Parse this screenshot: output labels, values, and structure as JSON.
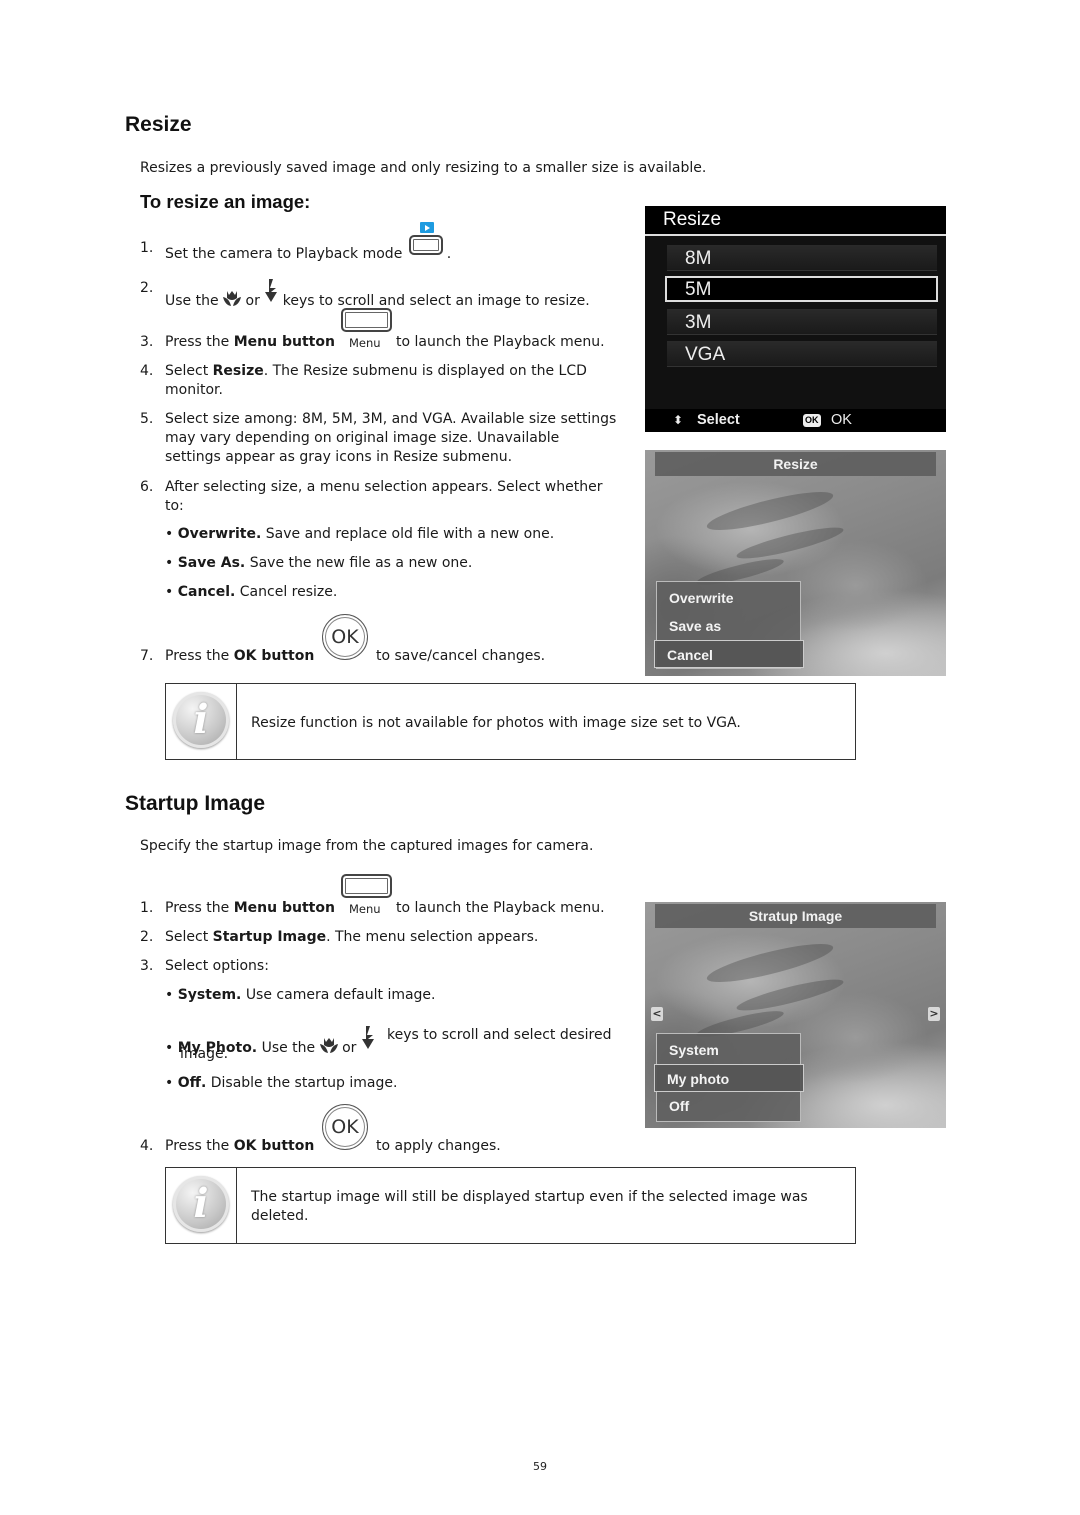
{
  "resize": {
    "title": "Resize",
    "intro": "Resizes a previously saved image and only resizing to a smaller size is available.",
    "subtitle": "To resize an image:",
    "steps": [
      {
        "n": "1.",
        "text_a": "Set the camera to Playback mode",
        "text_b": "."
      },
      {
        "n": "2.",
        "text_a": "Use the",
        "text_or": "or",
        "text_b": "keys to scroll and select an image to resize."
      },
      {
        "n": "3.",
        "text_a": "Press the",
        "bold": "Menu button",
        "key_label": "Menu",
        "text_b": "to launch the Playback menu."
      },
      {
        "n": "4.",
        "text_a": "Select",
        "bold": "Resize",
        "text_b": ". The Resize submenu is displayed on the LCD monitor."
      },
      {
        "n": "5.",
        "text": "Select size among: 8M, 5M, 3M, and VGA. Available size settings may vary depending on original image size. Unavailable settings appear as gray icons in Resize submenu."
      },
      {
        "n": "6.",
        "text": "After selecting size, a menu selection appears. Select whether to:"
      },
      {
        "n": "7.",
        "text_a": "Press the",
        "bold": "OK button",
        "key_label": "OK",
        "text_b": "to save/cancel changes."
      }
    ],
    "bullets": [
      {
        "bold": "Overwrite.",
        "text": "Save and replace old file with a new one."
      },
      {
        "bold": "Save As.",
        "text": "Save the new file as a new one."
      },
      {
        "bold": "Cancel.",
        "text": "Cancel resize."
      }
    ],
    "lcd_menu": {
      "title": "Resize",
      "items": [
        "8M",
        "5M",
        "3M",
        "VGA"
      ],
      "selected": "5M",
      "footer_select": "Select",
      "footer_ok_chip": "OK",
      "footer_ok": "OK"
    },
    "lcd_confirm": {
      "title": "Resize",
      "options": [
        "Overwrite",
        "Save as",
        "Cancel"
      ],
      "selected": "Cancel"
    },
    "note": "Resize function is not available for photos with image size set to VGA."
  },
  "startup": {
    "title": "Startup Image",
    "intro": "Specify the startup image from the captured images for camera.",
    "steps": [
      {
        "n": "1.",
        "text_a": "Press the",
        "bold": "Menu button",
        "key_label": "Menu",
        "text_b": "to launch the Playback menu."
      },
      {
        "n": "2.",
        "text_a": "Select",
        "bold": "Startup Image",
        "text_b": ". The menu selection appears."
      },
      {
        "n": "3.",
        "text": "Select options:"
      },
      {
        "n": "4.",
        "text_a": "Press the",
        "bold": "OK button",
        "key_label": "OK",
        "text_b": "to apply changes."
      }
    ],
    "bullets": [
      {
        "bold": "System.",
        "text": "Use camera default image."
      },
      {
        "bold": "My Photo.",
        "text_a": "Use the",
        "text_or": "or",
        "text_b": "keys to scroll and select desired image."
      },
      {
        "bold": "Off.",
        "text": "Disable the startup image."
      }
    ],
    "lcd": {
      "title": "Stratup Image",
      "options": [
        "System",
        "My photo",
        "Off"
      ],
      "selected": "My photo",
      "arrow_left": "<",
      "arrow_right": ">"
    },
    "note": "The startup image will still be displayed startup even if the selected image was deleted."
  },
  "icons": {
    "play": "playback-icon",
    "macro": "macro-flower-icon",
    "flash": "flash-icon",
    "info": "info-icon",
    "info_glyph": "i",
    "updown": "⬍"
  },
  "colors": {
    "playback_badge": "#1e9be0"
  },
  "page_number": "59"
}
